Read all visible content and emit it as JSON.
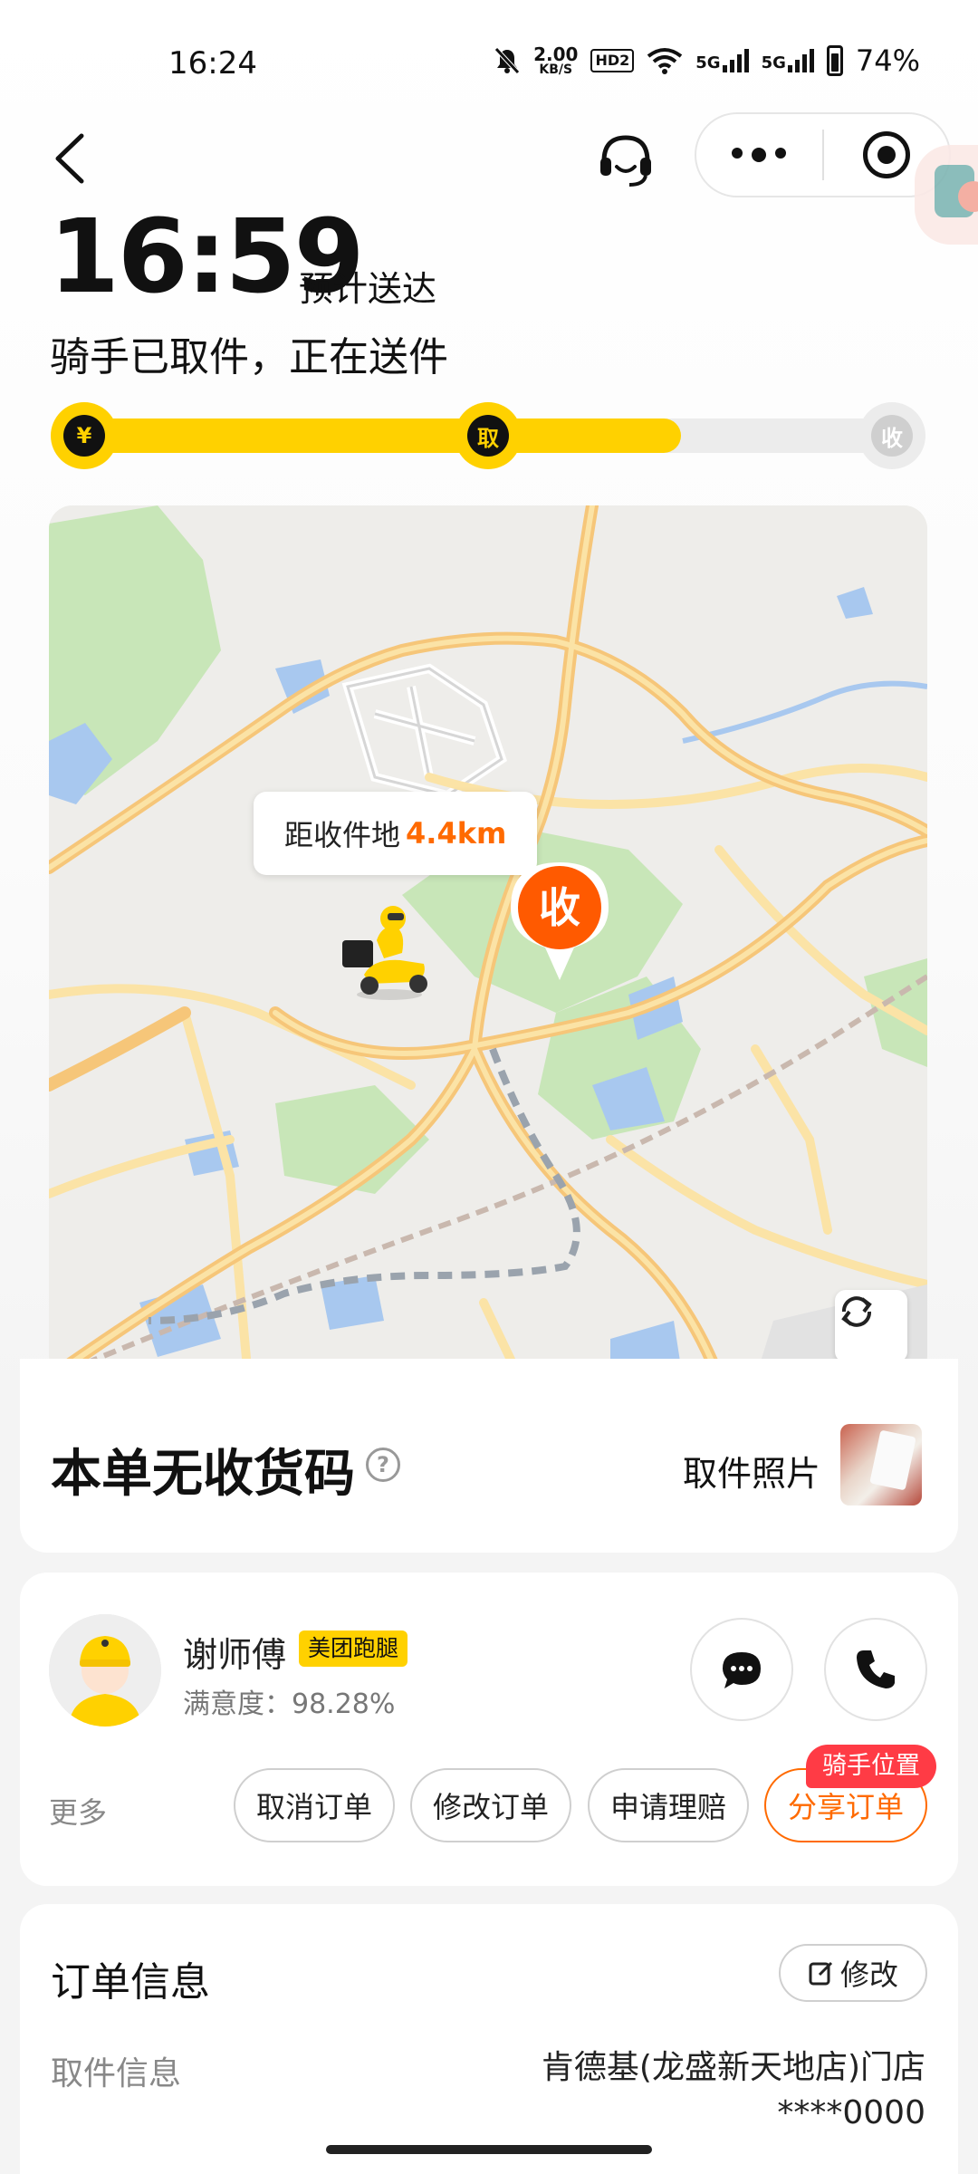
{
  "status_bar": {
    "time": "16:24",
    "net_speed_value": "2.00",
    "net_speed_unit": "KB/S",
    "hd_label": "HD2",
    "network_1": "5G",
    "network_2": "5G",
    "battery": "74%",
    "icons": [
      "mute-icon",
      "wifi-icon",
      "signal-icon",
      "battery-icon"
    ]
  },
  "nav": {
    "back_icon": "back-arrow-icon",
    "support_icon": "headset-icon",
    "more_icon": "more-dots-icon",
    "close_icon": "target-icon"
  },
  "eta": {
    "time": "16:59",
    "label": "预计送达",
    "status": "骑手已取件，正在送件"
  },
  "progress": {
    "fraction": 0.73,
    "nodes": [
      {
        "label": "¥",
        "state": "done"
      },
      {
        "label": "取",
        "state": "done"
      },
      {
        "label": "收",
        "state": "todo"
      }
    ],
    "colors": {
      "active": "#ffd100",
      "inactive": "#ececec"
    }
  },
  "map": {
    "distance_label": "距收件地",
    "distance_value": "4.4km",
    "pin_label": "收",
    "refresh_icon": "refresh-icon"
  },
  "code_card": {
    "title": "本单无收货码",
    "help": "?",
    "pickup_photo_label": "取件照片"
  },
  "rider": {
    "name": "谢师傅",
    "brand": "美团跑腿",
    "satisfaction": "满意度：98.28%",
    "more": "更多",
    "actions": [
      "取消订单",
      "修改订单",
      "申请理赔",
      "分享订单"
    ],
    "location_tag": "骑手位置"
  },
  "order_info": {
    "title": "订单信息",
    "edit": "修改",
    "pickup_label": "取件信息",
    "pickup_store": "肯德基(龙盛新天地店)门店",
    "pickup_phone": "****0000"
  },
  "colors": {
    "brand_yellow": "#ffd100",
    "accent_orange": "#ff6a00",
    "tag_red": "#ff3b45"
  }
}
